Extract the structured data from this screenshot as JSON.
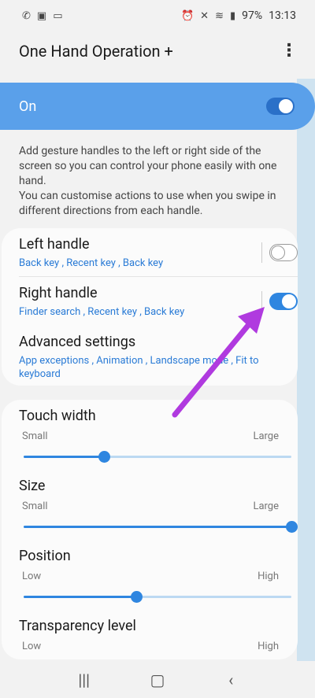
{
  "status_bar": {
    "battery": "97%",
    "time": "13:13",
    "left_icons": [
      "whatsapp-icon",
      "image-icon",
      "laptop-icon"
    ],
    "right_icons": [
      "alarm-icon",
      "mute-icon",
      "wifi-icon",
      "signal-icon"
    ]
  },
  "header": {
    "title": "One Hand Operation +"
  },
  "master_switch": {
    "label": "On",
    "state": true
  },
  "description": {
    "line1": "Add gesture handles to the left or right side of the screen so you can control your phone easily with one hand.",
    "line2": "You can customise actions to use when you swipe in different directions from each handle."
  },
  "handles": {
    "left": {
      "title": "Left handle",
      "actions": "Back key , Recent key , Back key",
      "enabled": false
    },
    "right": {
      "title": "Right handle",
      "actions": "Finder search , Recent key , Back key",
      "enabled": true
    },
    "advanced": {
      "title": "Advanced settings",
      "actions": "App exceptions , Animation , Landscape mode , Fit to keyboard"
    }
  },
  "sliders": {
    "touch_width": {
      "title": "Touch width",
      "min_label": "Small",
      "max_label": "Large",
      "value": 0.3
    },
    "size": {
      "title": "Size",
      "min_label": "Small",
      "max_label": "Large",
      "value": 1.0
    },
    "position": {
      "title": "Position",
      "min_label": "Low",
      "max_label": "High",
      "value": 0.42
    },
    "transparency": {
      "title": "Transparency level",
      "min_label": "Low",
      "max_label": "High"
    }
  },
  "colors": {
    "accent": "#2f86e0",
    "master_bg": "#5aa0ea",
    "annotation_arrow": "#b03adf"
  }
}
